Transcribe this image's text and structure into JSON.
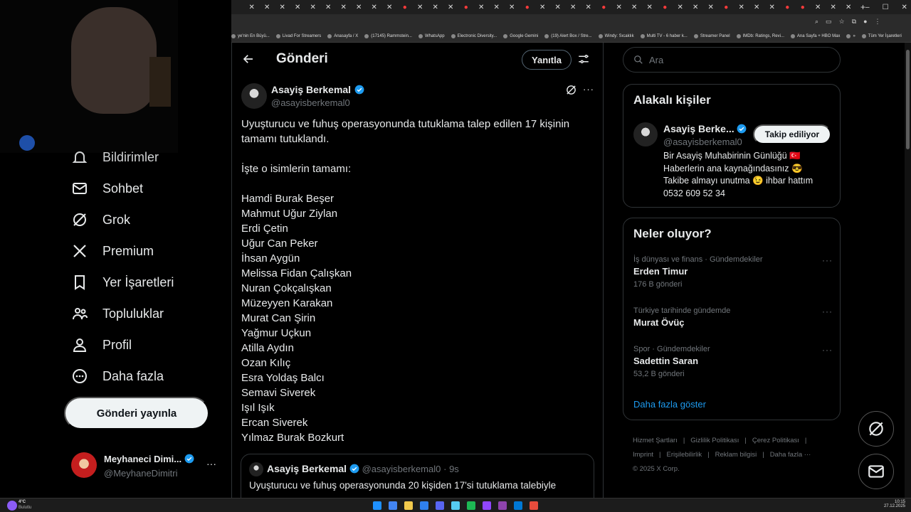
{
  "browser": {
    "tabs_count": 40,
    "new_tab_symbol": "+",
    "window_controls": [
      "–",
      "☐",
      "✕"
    ],
    "bookmarks": [
      "ye'nin En Büyü...",
      "Livad For Streamers",
      "Anasayfa / X",
      "(17145) Rammstein...",
      "WhatsApp",
      "Electronic Diversity...",
      "Google Gemini",
      "(19) Alert Box / Stre...",
      "Windy: Sıcaklık",
      "Multi TV - 6 haber k...",
      "Streamer Panel",
      "IMDb: Ratings, Revi...",
      "Ana Sayfa + HBO Max",
      "»",
      "Tüm Yer İşaretleri"
    ]
  },
  "nav": {
    "items": [
      {
        "label": "Bildirimler",
        "icon": "bell-icon"
      },
      {
        "label": "Sohbet",
        "icon": "mail-icon"
      },
      {
        "label": "Grok",
        "icon": "grok-icon"
      },
      {
        "label": "Premium",
        "icon": "x-logo-icon"
      },
      {
        "label": "Yer İşaretleri",
        "icon": "bookmark-icon"
      },
      {
        "label": "Topluluklar",
        "icon": "communities-icon"
      },
      {
        "label": "Profil",
        "icon": "person-icon"
      },
      {
        "label": "Daha fazla",
        "icon": "more-circle-icon"
      }
    ],
    "post_button": "Gönderi yayınla",
    "account": {
      "name": "Meyhaneci Dimi...",
      "handle": "@MeyhaneDimitri",
      "more": "···"
    }
  },
  "main": {
    "header_title": "Gönderi",
    "reply_button": "Yanıtla",
    "tweet": {
      "author_name": "Asayiş Berkemal",
      "author_handle": "@asayisberkemal0",
      "more": "···",
      "text_line1": "Uyuşturucu ve fuhuş operasyonunda tutuklama talep edilen 17 kişinin",
      "text_line2": "tamamı tutuklandı.",
      "intro": "İşte o isimlerin tamamı:",
      "names": [
        "Hamdi Burak Beşer",
        "Mahmut Uğur Ziylan",
        "Erdi Çetin",
        "Uğur Can Peker",
        "İhsan Aygün",
        "Melissa Fidan Çalışkan",
        "Nuran Çokçalışkan",
        "Müzeyyen Karakan",
        "Murat Can Şirin",
        "Yağmur Uçkun",
        "Atilla Aydın",
        "Ozan Kılıç",
        "Esra Yoldaş Balcı",
        "Semavi Siverek",
        "Işıl Işık",
        "Ercan Siverek",
        "Yılmaz Burak Bozkurt"
      ]
    },
    "quote": {
      "author_name": "Asayiş Berkemal",
      "author_handle": "@asayisberkemal0",
      "time": "· 9s",
      "text": "Uyuşturucu ve fuhuş operasyonunda 20 kişiden 17'si tutuklama talebiyle"
    }
  },
  "right": {
    "search_placeholder": "Ara",
    "related": {
      "title": "Alakalı kişiler",
      "name": "Asayiş Berke...",
      "handle": "@asayisberkemal0",
      "follow_button": "Takip ediliyor",
      "bio_line1": "Bir Asayiş Muhabirinin Günlüğü 🇹🇷",
      "bio_line2": "Haberlerin ana kaynağındasınız 😎",
      "bio_line3": "Takibe almayı unutma 😉 ihbar hattım",
      "bio_line4": "0532 609 52 34"
    },
    "trends": {
      "title": "Neler oluyor?",
      "items": [
        {
          "category": "İş dünyası ve finans · Gündemdekiler",
          "name": "Erden Timur",
          "count": "176 B gönderi"
        },
        {
          "category": "Türkiye tarihinde gündemde",
          "name": "Murat Övüç",
          "count": ""
        },
        {
          "category": "Spor · Gündemdekiler",
          "name": "Sadettin Saran",
          "count": "53,2 B gönderi"
        }
      ],
      "more": "···",
      "show_more": "Daha fazla göster"
    },
    "footer": {
      "links_row1": [
        "Hizmet Şartları",
        "|",
        "Gizlilik Politikası",
        "|",
        "Çerez Politikası",
        "|"
      ],
      "links_row2": [
        "Imprint",
        "|",
        "Erişilebilirlik",
        "|",
        "Reklam bilgisi",
        "|",
        "Daha fazla ···"
      ],
      "copyright": "© 2025 X Corp."
    }
  },
  "taskbar": {
    "weather_temp": "4°C",
    "weather_desc": "Bulutlu",
    "time": "10:15",
    "date": "27.12.2025"
  }
}
